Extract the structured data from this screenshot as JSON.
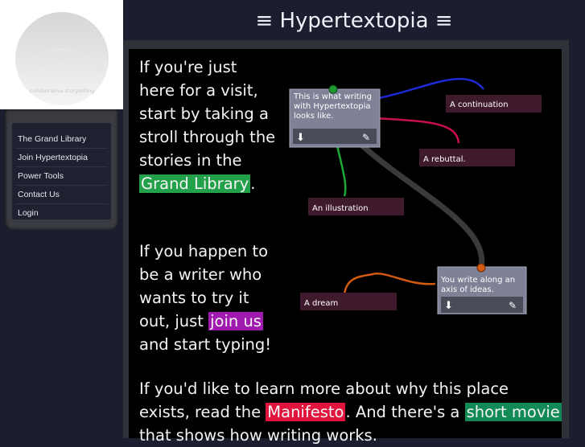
{
  "logo": {
    "subtitle": "collaborative storytelling"
  },
  "header": {
    "title": "≡ Hypertextopia ≡"
  },
  "nav": {
    "items": [
      "The Grand Library",
      "Join Hypertextopia",
      "Power Tools",
      "Contact Us",
      "Login"
    ]
  },
  "intro": {
    "p1_a": "If you're just here for a visit, start by taking a stroll through the stories in the ",
    "p1_link": "Grand Library",
    "p1_b": ".",
    "p2_a": "If you happen to be a writer who wants to try it out, just ",
    "p2_link": "join us",
    "p2_b": " and start typing!",
    "p3_a": "If you'd like to learn more about why this place exists, read the ",
    "p3_link1": "Manifesto",
    "p3_b": ". And there's a ",
    "p3_link2": "short movie",
    "p3_c": " that shows how writing works."
  },
  "diagram": {
    "card1": [
      "This is what writing",
      "with Hypertextopia",
      "looks like."
    ],
    "card2": [
      "You write along an",
      "axis of ideas."
    ],
    "continuation": "A continuation",
    "rebuttal": "A rebuttal.",
    "illustration": "An illustration",
    "dream": "A dream"
  },
  "colors": {
    "blue_link": "#1e2ad8",
    "crimson_link": "#c8104a",
    "green_link": "#1ea838",
    "orange_link": "#d45a10"
  },
  "icons": [
    "arrow-down-icon",
    "pencil-icon"
  ]
}
